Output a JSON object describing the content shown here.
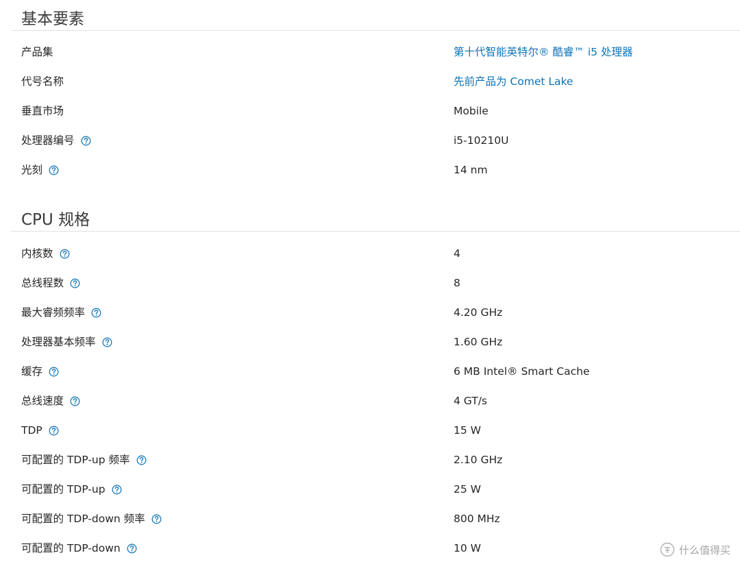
{
  "sections": [
    {
      "title": "基本要素",
      "rows": [
        {
          "label": "产品集",
          "value": "第十代智能英特尔® 酷睿™ i5 处理器",
          "help": false,
          "link": true
        },
        {
          "label": "代号名称",
          "value": "先前产品为 Comet Lake",
          "help": false,
          "link": true
        },
        {
          "label": "垂直市场",
          "value": "Mobile",
          "help": false,
          "link": false
        },
        {
          "label": "处理器编号",
          "value": "i5-10210U",
          "help": true,
          "link": false
        },
        {
          "label": "光刻",
          "value": "14 nm",
          "help": true,
          "link": false
        }
      ]
    },
    {
      "title": "CPU 规格",
      "rows": [
        {
          "label": "内核数",
          "value": "4",
          "help": true,
          "link": false
        },
        {
          "label": "总线程数",
          "value": "8",
          "help": true,
          "link": false
        },
        {
          "label": "最大睿频频率",
          "value": "4.20 GHz",
          "help": true,
          "link": false
        },
        {
          "label": "处理器基本频率",
          "value": "1.60 GHz",
          "help": true,
          "link": false
        },
        {
          "label": "缓存",
          "value": "6 MB Intel® Smart Cache",
          "help": true,
          "link": false
        },
        {
          "label": "总线速度",
          "value": "4 GT/s",
          "help": true,
          "link": false
        },
        {
          "label": "TDP",
          "value": "15 W",
          "help": true,
          "link": false
        },
        {
          "label": "可配置的 TDP-up 频率",
          "value": "2.10 GHz",
          "help": true,
          "link": false
        },
        {
          "label": "可配置的 TDP-up",
          "value": "25 W",
          "help": true,
          "link": false
        },
        {
          "label": "可配置的 TDP-down 频率",
          "value": "800 MHz",
          "help": true,
          "link": false
        },
        {
          "label": "可配置的 TDP-down",
          "value": "10 W",
          "help": true,
          "link": false
        }
      ]
    }
  ],
  "icons": {
    "help": "help-icon"
  },
  "colors": {
    "link": "#0b73b6",
    "help_icon": "#1a79b9",
    "text": "#262626",
    "rule": "#e2e2e2"
  },
  "watermark": {
    "text": "什么值得买"
  }
}
